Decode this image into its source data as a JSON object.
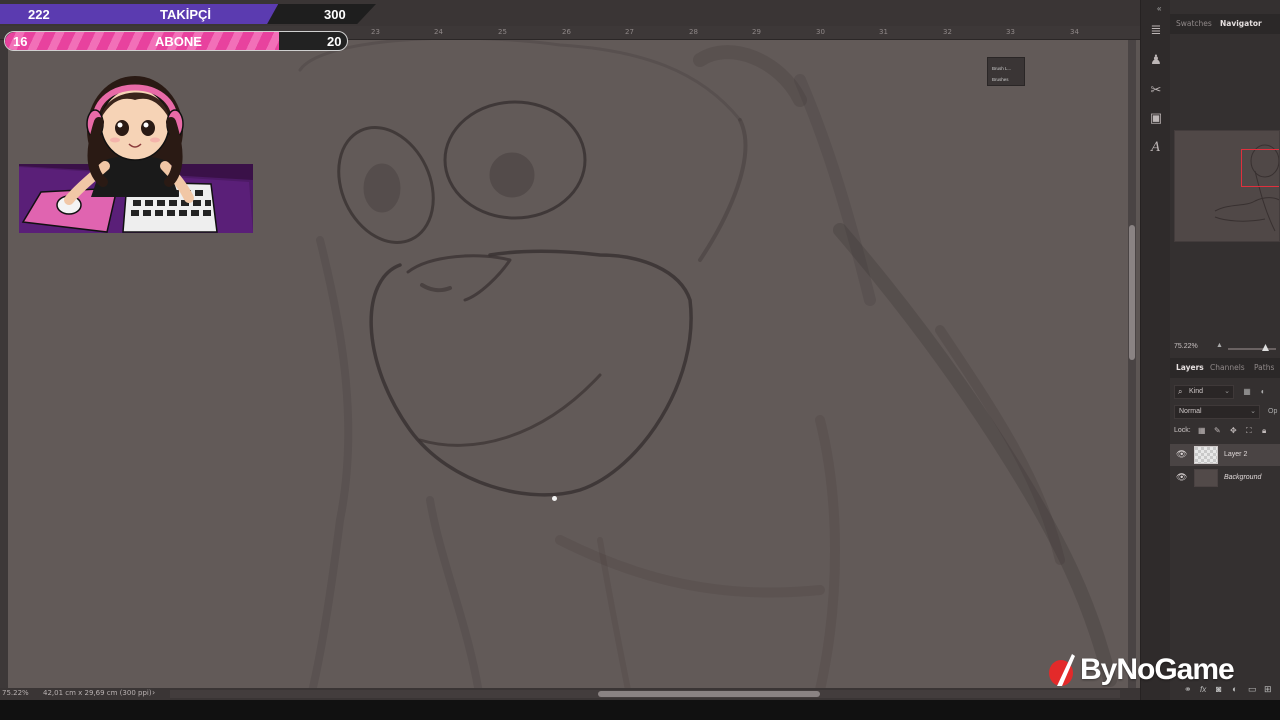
{
  "overlay": {
    "followers": {
      "label": "TAKİPÇİ",
      "current": "222",
      "goal": "300",
      "progress": 0.74,
      "color": "#5b3bb0"
    },
    "subscribers": {
      "label": "ABONE",
      "current": "16",
      "goal": "20",
      "progress": 0.8,
      "color": "#e8429e"
    }
  },
  "ruler": {
    "ticks": [
      "23",
      "24",
      "25",
      "26",
      "27",
      "28",
      "29",
      "30",
      "31",
      "32",
      "33",
      "34"
    ]
  },
  "brush_popup": {
    "line1": "Brush L...",
    "line2": "Brushes"
  },
  "status_bar": {
    "zoom": "75.22%",
    "doc_size": "42,01 cm x 29,69 cm (300 ppi)",
    "arrow": "›"
  },
  "panels": {
    "top_tabs": [
      "Swatches",
      "Navigator"
    ],
    "navigator_zoom": "75.22%",
    "layer_tabs": [
      "Layers",
      "Channels",
      "Paths"
    ],
    "filter_kind": "Kind",
    "blend_mode": "Normal",
    "opacity_label": "Op",
    "lock_label": "Lock:",
    "layers": [
      {
        "name": "Layer 2",
        "selected": true
      },
      {
        "name": "Background",
        "selected": false
      }
    ]
  },
  "tools": [
    "brush-settings-icon",
    "clone-source-icon",
    "scissors-icon",
    "layer-comps-icon",
    "glyphs-icon"
  ],
  "watermark": {
    "text": "ByNoGame"
  },
  "colors": {
    "canvas": "#625a58",
    "panel": "#343030",
    "accent_red": "#e0303d"
  }
}
